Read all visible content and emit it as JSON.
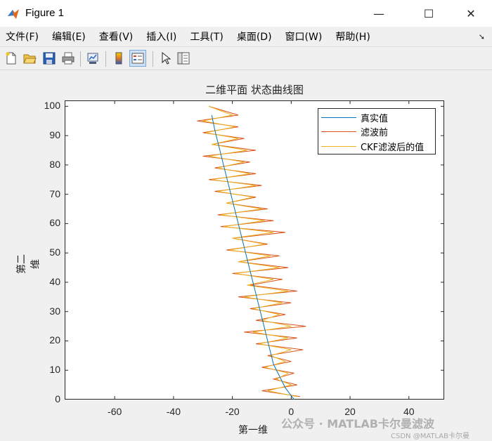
{
  "window": {
    "title": "Figure 1",
    "minimize": "—",
    "maximize": "☐",
    "close": "✕"
  },
  "menu": {
    "items": [
      "文件(F)",
      "编辑(E)",
      "查看(V)",
      "插入(I)",
      "工具(T)",
      "桌面(D)",
      "窗口(W)",
      "帮助(H)"
    ],
    "dock_arrow": "➘"
  },
  "toolbar": {
    "buttons": [
      "new-figure-icon",
      "open-file-icon",
      "save-icon",
      "print-icon",
      "link-plot-icon",
      "insert-colorbar-icon",
      "insert-legend-icon",
      "pointer-icon",
      "property-inspector-icon"
    ],
    "active": "insert-legend-icon"
  },
  "chart_data": {
    "type": "line",
    "title": "二维平面 状态曲线图",
    "xlabel": "第一维",
    "ylabel": "第二维",
    "xlim": [
      -77,
      52
    ],
    "ylim": [
      0,
      102
    ],
    "xticks": [
      -60,
      -40,
      -20,
      0,
      20,
      40
    ],
    "yticks": [
      0,
      10,
      20,
      30,
      40,
      50,
      60,
      70,
      80,
      90,
      100
    ],
    "legend_position": "top-right",
    "series": [
      {
        "name": "真实值",
        "color": "#0072BD",
        "x": [
          1,
          -2,
          -4,
          -6,
          -7,
          -8,
          -9,
          -10,
          -11,
          -12,
          -13,
          -14,
          -15,
          -16,
          -17,
          -18,
          -19,
          -20,
          -21,
          -22,
          -23,
          -24,
          -25,
          -26,
          -27
        ],
        "y": [
          0,
          4,
          8,
          12,
          16,
          20,
          24,
          28,
          32,
          36,
          40,
          44,
          48,
          52,
          56,
          60,
          64,
          68,
          72,
          76,
          80,
          84,
          88,
          92,
          97
        ]
      },
      {
        "name": "滤波前",
        "color": "#D95319",
        "x": [
          3,
          -10,
          2,
          -6,
          1,
          -10,
          0,
          -8,
          4,
          -12,
          2,
          -16,
          5,
          -12,
          -2,
          -14,
          0,
          -18,
          2,
          -14,
          -3,
          -20,
          -1,
          -18,
          -4,
          -22,
          -8,
          -20,
          -2,
          -24,
          -6,
          -25,
          -8,
          -22,
          -12,
          -26,
          -10,
          -28,
          -12,
          -26,
          -14,
          -30,
          -12,
          -27,
          -16,
          -30,
          -18,
          -32,
          -18,
          -28
        ],
        "y": [
          1,
          3,
          5,
          7,
          9,
          11,
          13,
          15,
          17,
          19,
          21,
          23,
          25,
          27,
          29,
          31,
          33,
          35,
          37,
          39,
          41,
          43,
          45,
          47,
          49,
          51,
          53,
          55,
          57,
          59,
          61,
          63,
          65,
          67,
          69,
          71,
          73,
          75,
          77,
          79,
          81,
          83,
          85,
          87,
          89,
          91,
          93,
          95,
          97,
          100
        ]
      },
      {
        "name": "CKF滤波后的值",
        "color": "#EDB120",
        "x": [
          2,
          -8,
          0,
          -5,
          -1,
          -9,
          -2,
          -7,
          0,
          -11,
          -1,
          -13,
          0,
          -10,
          -4,
          -13,
          -3,
          -16,
          -1,
          -15,
          -6,
          -19,
          -4,
          -18,
          -7,
          -21,
          -9,
          -20,
          -6,
          -23,
          -9,
          -24,
          -10,
          -22,
          -13,
          -25,
          -12,
          -27,
          -14,
          -25,
          -16,
          -28,
          -15,
          -27,
          -18,
          -29,
          -19,
          -30,
          -20,
          -28
        ],
        "y": [
          1,
          3,
          5,
          7,
          9,
          11,
          13,
          15,
          17,
          19,
          21,
          23,
          25,
          27,
          29,
          31,
          33,
          35,
          37,
          39,
          41,
          43,
          45,
          47,
          49,
          51,
          53,
          55,
          57,
          59,
          61,
          63,
          65,
          67,
          69,
          71,
          73,
          75,
          77,
          79,
          81,
          83,
          85,
          87,
          89,
          91,
          93,
          95,
          97,
          100
        ]
      }
    ]
  },
  "watermark": {
    "text": "公众号 · MATLAB卡尔曼滤波",
    "source": "CSDN @MATLAB卡尔曼"
  }
}
